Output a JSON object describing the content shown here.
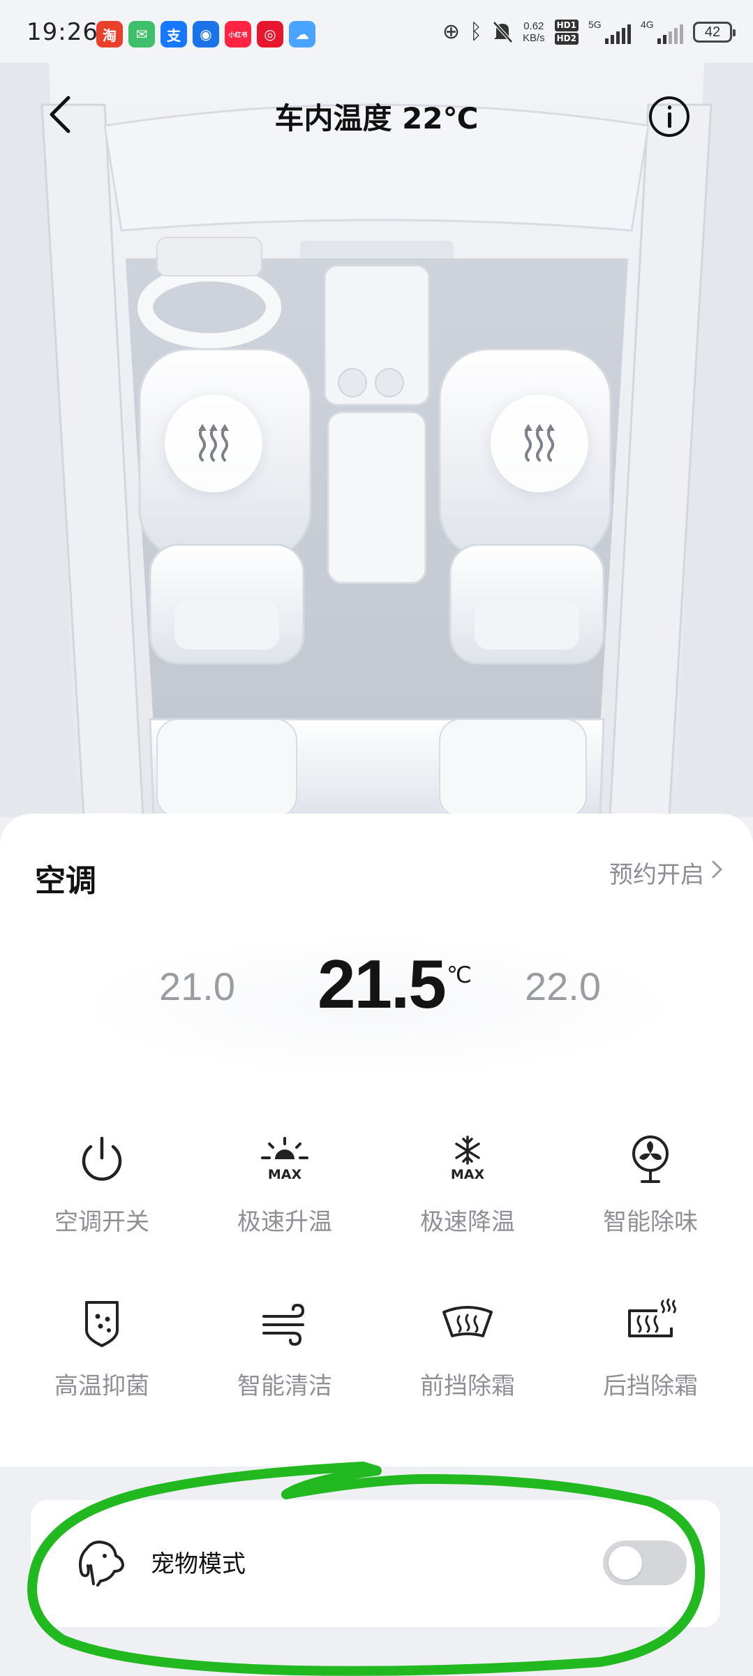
{
  "status_bar": {
    "time": "19:26",
    "net_speed_value": "0.62",
    "net_speed_unit": "KB/s",
    "hd1": "HD1",
    "hd2": "HD2",
    "sig1_label": "5G",
    "sig2_label": "4G",
    "battery": "42",
    "app_icons": [
      {
        "name": "taobao-app-icon",
        "glyph": "淘",
        "color": "#e8402a"
      },
      {
        "name": "messages-app-icon",
        "glyph": "✉",
        "color": "#3fbf6a"
      },
      {
        "name": "alipay-app-icon",
        "glyph": "支",
        "color": "#1677ff"
      },
      {
        "name": "bot-app-icon",
        "glyph": "◉",
        "color": "#1a73e8"
      },
      {
        "name": "xiaohongshu-app-icon",
        "glyph": "小红书",
        "color": "#ff2442"
      },
      {
        "name": "weibo-app-icon",
        "glyph": "◎",
        "color": "#e6162d"
      },
      {
        "name": "cloud-app-icon",
        "glyph": "☁",
        "color": "#4aa3ff"
      }
    ]
  },
  "header": {
    "title": "车内温度 22℃"
  },
  "ac": {
    "title": "空调",
    "schedule_label": "预约开启",
    "temp_prev": "21.0",
    "temp_current": "21.5",
    "temp_unit": "℃",
    "temp_next": "22.0",
    "functions": [
      {
        "label": "空调开关",
        "icon": "power-icon"
      },
      {
        "label": "极速升温",
        "icon": "sun-max-icon"
      },
      {
        "label": "极速降温",
        "icon": "snowflake-max-icon"
      },
      {
        "label": "智能除味",
        "icon": "fan-icon"
      },
      {
        "label": "高温抑菌",
        "icon": "shield-dots-icon"
      },
      {
        "label": "智能清洁",
        "icon": "wind-icon"
      },
      {
        "label": "前挡除霜",
        "icon": "front-defrost-icon"
      },
      {
        "label": "后挡除霜",
        "icon": "rear-defrost-icon"
      }
    ],
    "max_label": "MAX"
  },
  "pet_mode": {
    "label": "宠物模式",
    "enabled": false
  },
  "colors": {
    "accent_annotation": "#22b820",
    "label_gray": "#8e9096"
  }
}
